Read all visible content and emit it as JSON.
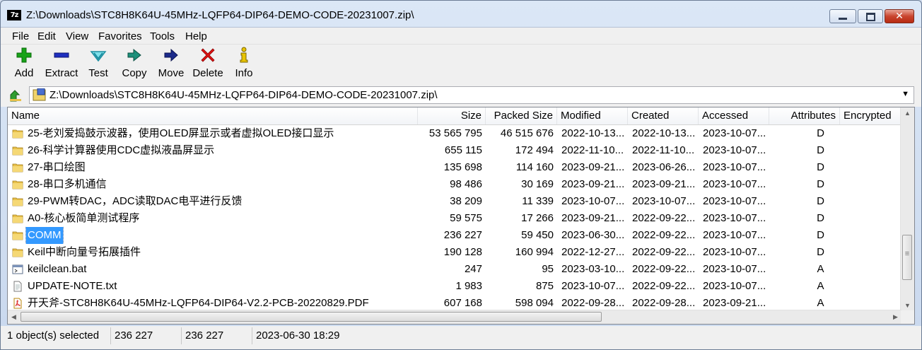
{
  "window": {
    "title": "Z:\\Downloads\\STC8H8K64U-45MHz-LQFP64-DIP64-DEMO-CODE-20231007.zip\\",
    "app_icon_text": "7z",
    "close_glyph": "✕"
  },
  "menu": [
    "File",
    "Edit",
    "View",
    "Favorites",
    "Tools",
    "Help"
  ],
  "toolbar": [
    {
      "label": "Add",
      "icon": "plus-icon",
      "color": "#19a319"
    },
    {
      "label": "Extract",
      "icon": "minus-icon",
      "color": "#1f2fbf"
    },
    {
      "label": "Test",
      "icon": "checkmark-icon",
      "color": "#2bb7c9"
    },
    {
      "label": "Copy",
      "icon": "double-arrow-right-icon",
      "color": "#1d8f7a"
    },
    {
      "label": "Move",
      "icon": "arrow-right-icon",
      "color": "#1b2a8a"
    },
    {
      "label": "Delete",
      "icon": "x-icon",
      "color": "#e01010"
    },
    {
      "label": "Info",
      "icon": "info-icon",
      "color": "#d8b400"
    }
  ],
  "address": {
    "path": "Z:\\Downloads\\STC8H8K64U-45MHz-LQFP64-DIP64-DEMO-CODE-20231007.zip\\"
  },
  "columns": [
    "Name",
    "Size",
    "Packed Size",
    "Modified",
    "Created",
    "Accessed",
    "Attributes",
    "Encrypted"
  ],
  "files": [
    {
      "name": "25-老刘爱捣鼓示波器，使用OLED屏显示或者虚拟OLED接口显示",
      "size": "53 565 795",
      "packed": "46 515 676",
      "modified": "2022-10-13...",
      "created": "2022-10-13...",
      "accessed": "2023-10-07...",
      "attr": "D",
      "icon": "folder-icon"
    },
    {
      "name": "26-科学计算器使用CDC虚拟液晶屏显示",
      "size": "655 115",
      "packed": "172 494",
      "modified": "2022-11-10...",
      "created": "2022-11-10...",
      "accessed": "2023-10-07...",
      "attr": "D",
      "icon": "folder-icon"
    },
    {
      "name": "27-串口绘图",
      "size": "135 698",
      "packed": "114 160",
      "modified": "2023-09-21...",
      "created": "2023-06-26...",
      "accessed": "2023-10-07...",
      "attr": "D",
      "icon": "folder-icon"
    },
    {
      "name": "28-串口多机通信",
      "size": "98 486",
      "packed": "30 169",
      "modified": "2023-09-21...",
      "created": "2023-09-21...",
      "accessed": "2023-10-07...",
      "attr": "D",
      "icon": "folder-icon"
    },
    {
      "name": "29-PWM转DAC，ADC读取DAC电平进行反馈",
      "size": "38 209",
      "packed": "11 339",
      "modified": "2023-10-07...",
      "created": "2023-10-07...",
      "accessed": "2023-10-07...",
      "attr": "D",
      "icon": "folder-icon"
    },
    {
      "name": "A0-核心板简单测试程序",
      "size": "59 575",
      "packed": "17 266",
      "modified": "2023-09-21...",
      "created": "2022-09-22...",
      "accessed": "2023-10-07...",
      "attr": "D",
      "icon": "folder-icon"
    },
    {
      "name": "COMM",
      "size": "236 227",
      "packed": "59 450",
      "modified": "2023-06-30...",
      "created": "2022-09-22...",
      "accessed": "2023-10-07...",
      "attr": "D",
      "icon": "folder-icon",
      "selected": true
    },
    {
      "name": "Keil中断向量号拓展插件",
      "size": "190 128",
      "packed": "160 994",
      "modified": "2022-12-27...",
      "created": "2022-09-22...",
      "accessed": "2023-10-07...",
      "attr": "D",
      "icon": "folder-icon"
    },
    {
      "name": "keilclean.bat",
      "size": "247",
      "packed": "95",
      "modified": "2023-03-10...",
      "created": "2022-09-22...",
      "accessed": "2023-10-07...",
      "attr": "A",
      "icon": "batch-file-icon"
    },
    {
      "name": "UPDATE-NOTE.txt",
      "size": "1 983",
      "packed": "875",
      "modified": "2023-10-07...",
      "created": "2022-09-22...",
      "accessed": "2023-10-07...",
      "attr": "A",
      "icon": "text-file-icon"
    },
    {
      "name": "开天斧-STC8H8K64U-45MHz-LQFP64-DIP64-V2.2-PCB-20220829.PDF",
      "size": "607 168",
      "packed": "598 094",
      "modified": "2022-09-28...",
      "created": "2022-09-28...",
      "accessed": "2023-09-21...",
      "attr": "A",
      "icon": "pdf-file-icon"
    }
  ],
  "status": {
    "selected": "1 object(s) selected",
    "size": "236 227",
    "packed": "236 227",
    "modified": "2023-06-30 18:29"
  }
}
